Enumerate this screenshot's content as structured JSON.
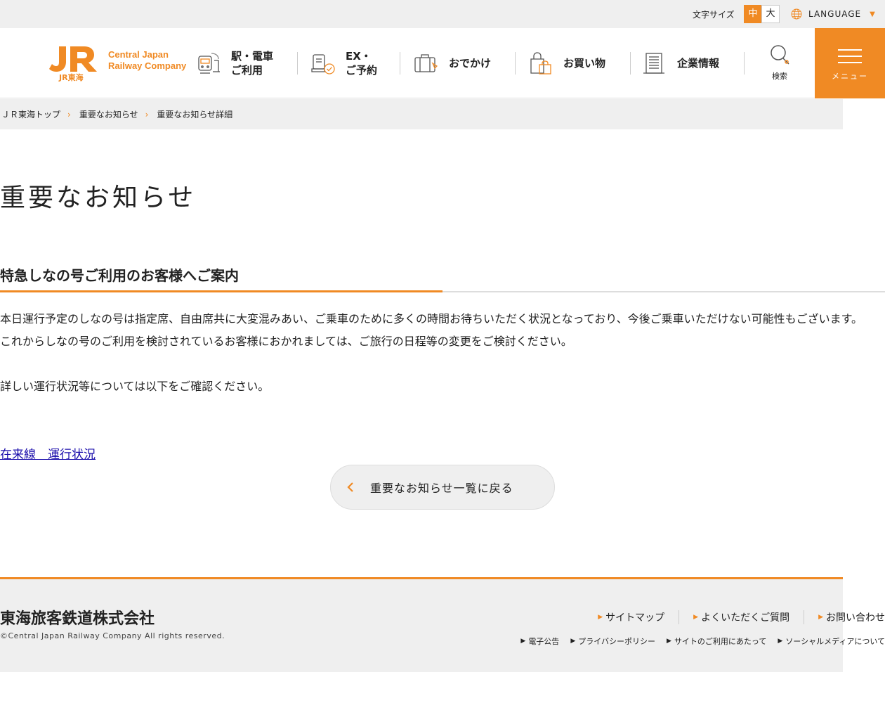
{
  "util": {
    "font_size_label": "文字サイズ",
    "font_size_medium": "中",
    "font_size_large": "大",
    "language_label": "LANGUAGE"
  },
  "header": {
    "logo_mark": "JR",
    "logo_sub": "JR東海",
    "company_en_line1": "Central Japan",
    "company_en_line2": "Railway Company",
    "nav": [
      {
        "label": "駅・電車\nご利用",
        "icon": "train-station-icon"
      },
      {
        "label": "EX・\nご予約",
        "icon": "reservation-icon"
      },
      {
        "label": "おでかけ",
        "icon": "suitcase-icon"
      },
      {
        "label": "お買い物",
        "icon": "shopping-bag-icon"
      },
      {
        "label": "企業情報",
        "icon": "building-icon"
      }
    ],
    "search_label": "検索",
    "menu_label": "メニュー"
  },
  "breadcrumb": [
    "ＪＲ東海トップ",
    "重要なお知らせ",
    "重要なお知らせ詳細"
  ],
  "main": {
    "page_title": "重要なお知らせ",
    "notice_heading": "特急しなの号ご利用のお客様へご案内",
    "paragraphs": [
      "本日運行予定のしなの号は指定席、自由席共に大変混みあい、ご乗車のために多くの時間お待ちいただく状況となっており、今後ご乗車いただけない可能性もございます。",
      "これからしなの号のご利用を検討されているお客様におかれましては、ご旅行の日程等の変更をご検討ください。",
      "詳しい運行状況等については以下をご確認ください。"
    ],
    "link_text": "在来線　運行状況",
    "back_button": "重要なお知らせ一覧に戻る"
  },
  "footer": {
    "company_name": "東海旅客鉄道株式会社",
    "copyright": "©Central Japan Railway Company All rights reserved.",
    "links_primary": [
      "サイトマップ",
      "よくいただくご質問",
      "お問い合わせ"
    ],
    "links_secondary": [
      "電子公告",
      "プライバシーポリシー",
      "サイトのご利用にあたって",
      "ソーシャルメディアについて"
    ]
  },
  "colors": {
    "accent": "#f08a24",
    "link": "#1a0dab",
    "bar_gray": "#efefef"
  }
}
